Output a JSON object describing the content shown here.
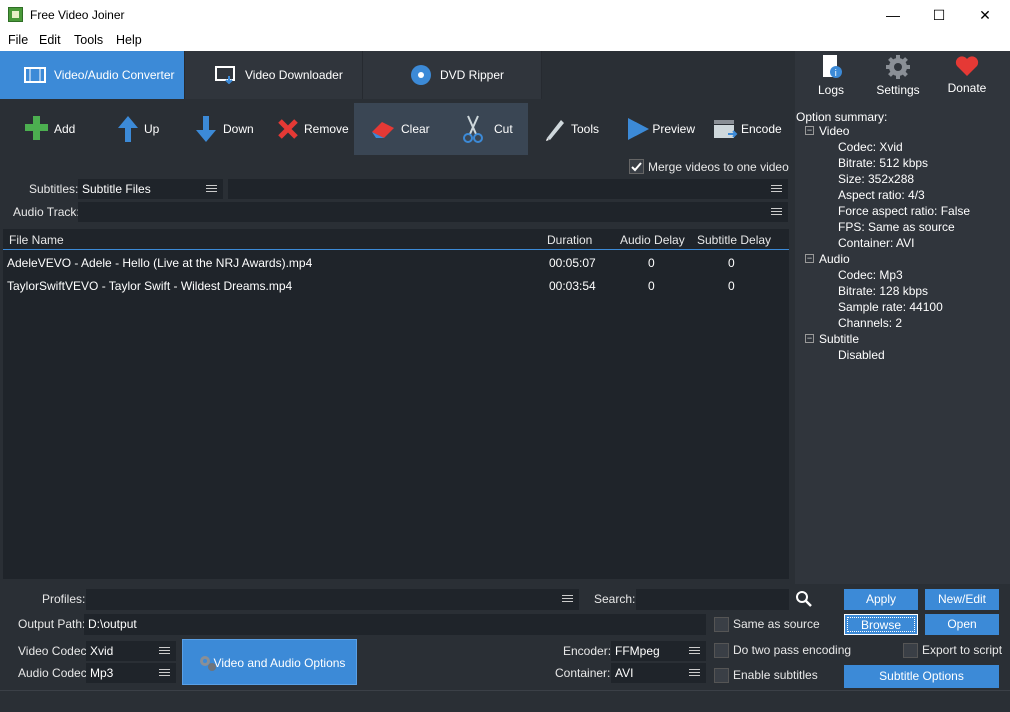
{
  "window": {
    "title": "Free Video Joiner",
    "minimize": "—",
    "maximize": "☐",
    "close": "✕"
  },
  "menu": [
    "File",
    "Edit",
    "Tools",
    "Help"
  ],
  "tabs": [
    "Video/Audio Converter",
    "Video Downloader",
    "DVD Ripper"
  ],
  "top_right": {
    "logs": "Logs",
    "settings": "Settings",
    "donate": "Donate"
  },
  "toolbar": [
    "Add",
    "Up",
    "Down",
    "Remove",
    "Clear",
    "Cut",
    "Tools",
    "Preview",
    "Encode"
  ],
  "merge_label": "Merge videos to one video",
  "subtitles": {
    "label": "Subtitles:",
    "value": "Subtitle Files"
  },
  "audio_track": {
    "label": "Audio Track:"
  },
  "columns": [
    "File Name",
    "Duration",
    "Audio Delay",
    "Subtitle Delay"
  ],
  "files": [
    {
      "name": "AdeleVEVO - Adele - Hello (Live at the NRJ Awards).mp4",
      "duration": "00:05:07",
      "audio_delay": "0",
      "subtitle_delay": "0"
    },
    {
      "name": "TaylorSwiftVEVO - Taylor Swift - Wildest Dreams.mp4",
      "duration": "00:03:54",
      "audio_delay": "0",
      "subtitle_delay": "0"
    }
  ],
  "summary": {
    "title": "Option summary:",
    "video": {
      "label": "Video",
      "items": [
        "Codec: Xvid",
        "Bitrate: 512 kbps",
        "Size: 352x288",
        "Aspect ratio: 4/3",
        "Force aspect ratio: False",
        "FPS: Same as source",
        "Container: AVI"
      ]
    },
    "audio": {
      "label": "Audio",
      "items": [
        "Codec: Mp3",
        "Bitrate: 128 kbps",
        "Sample rate: 44100",
        "Channels: 2"
      ]
    },
    "subtitle": {
      "label": "Subtitle",
      "items": [
        "Disabled"
      ]
    }
  },
  "bottom": {
    "profiles_label": "Profiles:",
    "search_label": "Search:",
    "output_label": "Output Path:",
    "output_value": "D:\\output",
    "video_codec_label": "Video Codec:",
    "video_codec": "Xvid",
    "audio_codec_label": "Audio Codec:",
    "audio_codec": "Mp3",
    "options_button": "Video and Audio Options",
    "encoder_label": "Encoder:",
    "encoder": "FFMpeg",
    "container_label": "Container:",
    "container": "AVI",
    "same_as_source": "Same as source",
    "two_pass": "Do two pass encoding",
    "enable_subtitles": "Enable subtitles",
    "apply": "Apply",
    "new_edit": "New/Edit",
    "browse": "Browse",
    "open": "Open",
    "export_script": "Export to script",
    "subtitle_options": "Subtitle Options"
  },
  "colors": {
    "accent": "#3c8ad7",
    "background": "#2a2f35",
    "grid": "#1f242a"
  }
}
